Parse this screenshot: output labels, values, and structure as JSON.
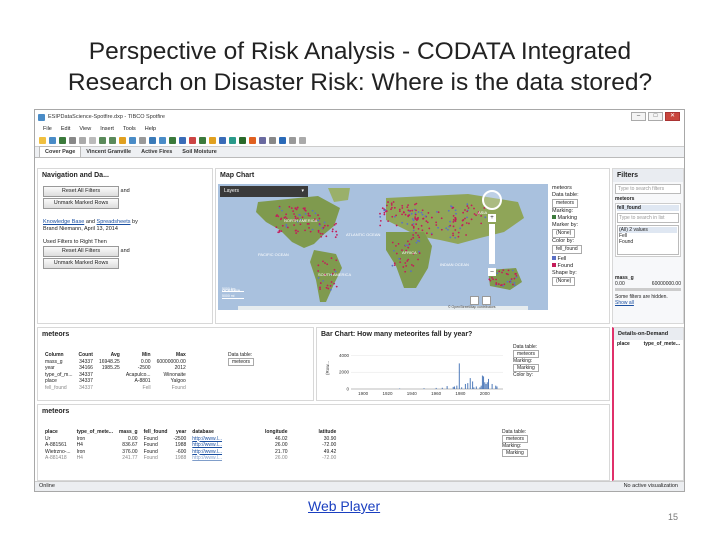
{
  "slide": {
    "title_line1": "Perspective of Risk Analysis - CODATA Integrated",
    "title_line2": "Research on Disaster Risk: Where is the data stored?",
    "link": "Web Player",
    "page_number": "15"
  },
  "window": {
    "title": "ESIPDataScience-Spotfire.dxp - TIBCO Spotfire",
    "menu": [
      "File",
      "Edit",
      "View",
      "Insert",
      "Tools",
      "Help"
    ],
    "tabs": [
      "Cover Page",
      "Vincent Granville",
      "Active Fires",
      "Soil Moisture"
    ],
    "status_left": "Online",
    "status_right": "No active visualization"
  },
  "nav": {
    "title": "Navigation and Da...",
    "reset1": "Reset All Filters",
    "and1": "and",
    "unmark1": "Unmark Marked Rows",
    "kb_link": "Knowledge Base",
    "and_text": "and",
    "ss_link": "Spreadsheets",
    "by_text": "by",
    "author": "Brand Niemann, April 13, 2014",
    "used": "Used Filters to Right Then",
    "reset2": "Reset All Filters",
    "and2": "and",
    "unmark2": "Unmark Marked Rows"
  },
  "map": {
    "title": "Map Chart",
    "layers": "Layers",
    "legend_title": "meteors",
    "data_table_label": "Data table:",
    "data_table_value": "meteors",
    "marking_label": "Marking:",
    "marking_value": "Marking",
    "marker_by_label": "Marker by:",
    "marker_by_value": "(None)",
    "color_by_label": "Color by:",
    "color_by_value": "fell_found",
    "legend_fell": "Fell",
    "legend_found": "Found",
    "shape_by_label": "Shape by:",
    "shape_by_value": "(None)",
    "scale_km": "5000 km",
    "scale_mi": "5000 mi",
    "attribution": "© OpenStreetMap contributors",
    "labels": {
      "north_america": "NORTH AMERICA",
      "atlantic": "ATLANTIC OCEAN",
      "pacific": "PACIFIC OCEAN",
      "south_america": "SOUTH AMERICA",
      "indian": "INDIAN OCEAN",
      "africa": "AFRICA",
      "oceania": "OCEANIA",
      "asia": "ASIA"
    }
  },
  "filters": {
    "title": "Filters",
    "search_placeholder": "Type to search filters",
    "group": "meteors",
    "field": "fell_found",
    "search_list_placeholder": "Type to search in list",
    "values": [
      "(All) 2 values",
      "Fell",
      "Found"
    ],
    "range_field": "mass_g",
    "range_min": "0.00",
    "range_max": "60000000.00",
    "hidden_note": "Some filters are hidden.",
    "show_all": "Show all"
  },
  "details": {
    "title": "Details-on-Demand",
    "col1": "place",
    "col2": "type_of_mete..."
  },
  "summary": {
    "title": "meteors",
    "headers": [
      "Column",
      "Count",
      "Avg",
      "Min",
      "Max"
    ],
    "rows": [
      [
        "mass_g",
        "34337",
        "16948.25",
        "0.00",
        "60000000.00"
      ],
      [
        "year",
        "34166",
        "1985.25",
        "-2500",
        "2012"
      ],
      [
        "type_of_m...",
        "34337",
        "",
        "Acapulco...",
        "Winonaite"
      ],
      [
        "place",
        "34337",
        "",
        "A-8801",
        "Yalgoo"
      ],
      [
        "fell_found",
        "34337",
        "",
        "Fell",
        "Found"
      ]
    ],
    "data_table_label": "Data table:",
    "data_table_value": "meteors"
  },
  "bar": {
    "title": "Bar Chart: How many meteorites fall by year?",
    "ylabel": "(Row...",
    "data_table_label": "Data table:",
    "data_table_value": "meteors",
    "marking_label": "Marking:",
    "marking_value": "Marking",
    "color_by_label": "Color by:"
  },
  "chart_data": {
    "type": "bar",
    "title": "Bar Chart: How many meteorites fall by year?",
    "xlabel": "",
    "ylabel": "(Row...",
    "xlim": [
      1890,
      2015
    ],
    "ylim": [
      0,
      5000
    ],
    "xticks": [
      1900,
      1920,
      1940,
      1960,
      1980,
      2000
    ],
    "yticks": [
      0,
      2000,
      4000
    ],
    "series": [
      {
        "x": [
          1930,
          1950,
          1960,
          1965,
          1969,
          1974,
          1975,
          1977,
          1979,
          1981,
          1984,
          1986,
          1988,
          1990,
          1991,
          1993,
          1996,
          1997,
          1998,
          1999,
          2000,
          2001,
          2002,
          2003,
          2006,
          2009,
          2010
        ],
        "values": [
          60,
          90,
          130,
          150,
          350,
          250,
          300,
          400,
          3050,
          200,
          600,
          700,
          1300,
          900,
          200,
          300,
          200,
          400,
          1600,
          1500,
          800,
          600,
          800,
          1200,
          600,
          400,
          300
        ]
      }
    ]
  },
  "table": {
    "title": "meteors",
    "headers": [
      "place",
      "type_of_mete...",
      "mass_g",
      "fell_found",
      "year",
      "database",
      "longitude",
      "latitude"
    ],
    "rows": [
      [
        "Ur",
        "Iron",
        "0.00",
        "Found",
        "-2500",
        "http://www.l...",
        "46.02",
        "30.90"
      ],
      [
        "A-881561",
        "H4",
        "836.67",
        "Found",
        "1988",
        "http://www.l...",
        "26.00",
        "-72.00"
      ],
      [
        "Wietrzno-...",
        "Iron",
        "376.00",
        "Found",
        "-600",
        "http://www.l...",
        "21.70",
        "49.42"
      ],
      [
        "A-881418",
        "H4",
        "241.77",
        "Found",
        "1988",
        "http://www.l...",
        "26.00",
        "-72.00"
      ]
    ],
    "data_table_label": "Data table:",
    "data_table_value": "meteors",
    "marking_label": "Marking:",
    "marking_value": "Marking"
  },
  "colors": {
    "fell": "#5a6fc4",
    "found": "#c41c5a",
    "map_ocean": "#a9c1de",
    "map_land": "#7f9a4e",
    "bar": "#3d6db3"
  }
}
